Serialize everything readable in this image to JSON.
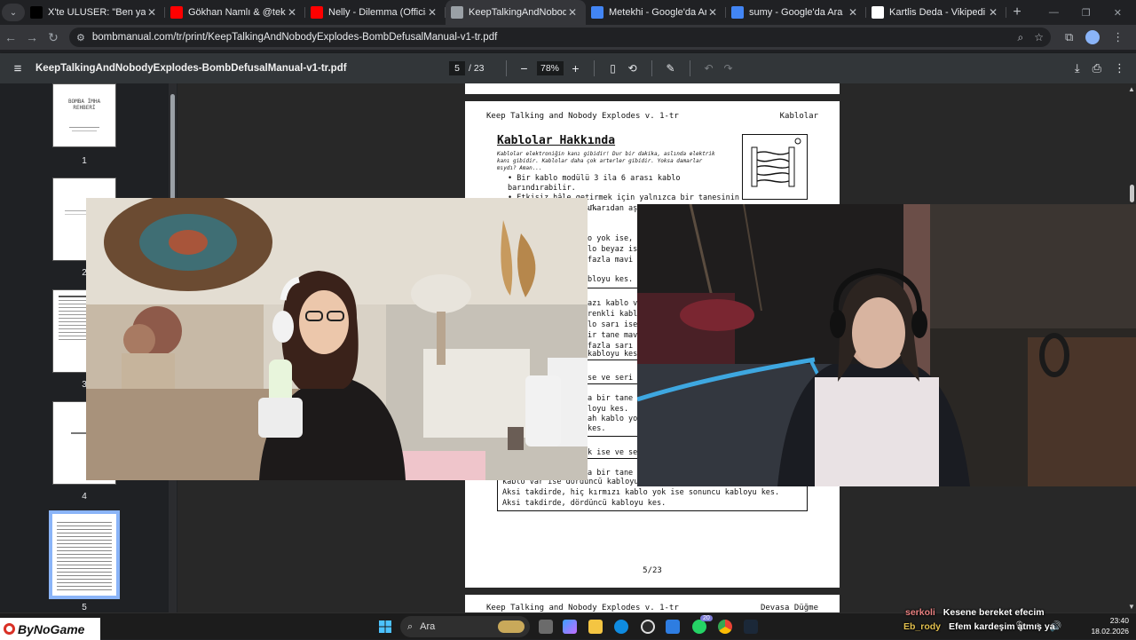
{
  "browser": {
    "tabs": [
      {
        "title": "X'te ULUSER: \"Ben yanlışım du",
        "favicon": "x-icon",
        "color": "#000000",
        "active": false
      },
      {
        "title": "Gökhan Namlı & @tekironline",
        "favicon": "youtube-icon",
        "color": "#ff0000",
        "active": false
      },
      {
        "title": "Nelly - Dilemma (Official Music",
        "favicon": "youtube-icon",
        "color": "#ff0000",
        "active": false
      },
      {
        "title": "KeepTalkingAndNobodyExplode",
        "favicon": "globe-icon",
        "color": "#9aa0a6",
        "active": true
      },
      {
        "title": "Metekhi - Google'da Ara",
        "favicon": "google-icon",
        "color": "#4285f4",
        "active": false
      },
      {
        "title": "sumy - Google'da Ara",
        "favicon": "google-icon",
        "color": "#4285f4",
        "active": false
      },
      {
        "title": "Kartlis Deda - Vikipedi",
        "favicon": "wikipedia-icon",
        "color": "#ffffff",
        "active": false
      }
    ],
    "url": "bombmanual.com/tr/print/KeepTalkingAndNobodyExplodes-BombDefusalManual-v1-tr.pdf"
  },
  "pdf": {
    "filename": "KeepTalkingAndNobodyExplodes-BombDefusalManual-v1-tr.pdf",
    "current_page": "5",
    "total_pages": "/ 23",
    "zoom": "78%",
    "thumbnails": [
      {
        "num": "1",
        "title": "BOMBA İMHA REHBERİ"
      },
      {
        "num": "2"
      },
      {
        "num": "3"
      },
      {
        "num": "4"
      },
      {
        "num": "5"
      }
    ]
  },
  "page5": {
    "header_left": "Keep Talking and Nobody Explodes v. 1-tr",
    "header_right": "Kablolar",
    "title": "Kablolar Hakkında",
    "intro": "Kablolar elektroniğin kanı gibidir! Dur bir dakika, aslında elektrik kanı gibidir. Kablolar daha çok arterler gibidir. Yoksa damarlar mıydı? Aman...",
    "bullet1": "• Bir kablo modülü 3 ila 6 arası kablo barındırabilir.",
    "bullet2": "• Etkisiz hâle getirmek için yalnızca bir tanesinin",
    "bullet2b": "kesilmesi gerekir.",
    "frag1": "ukarıdan aşa",
    "frag2": "o yok ise, iki",
    "frag3": "lo beyaz ise,",
    "frag4": "fazla mavi ka",
    "frag5": "bloyu kes.",
    "frag6": "azı kablo va",
    "frag7": "renkli kablo",
    "frag8": "lo sarı ise v",
    "frag9": "ir tane mavi",
    "frag10": "fazla sarı k",
    "frag11": "kabloyu kes.",
    "frag12": "se ve seri nu",
    "frag13": "a bir tane k",
    "frag14": "loyu kes.",
    "frag15": "ah kablo yok",
    "frag16": "kes.",
    "frag17": "k ise ve seri",
    "frag18": "a bir tane s",
    "line_a": "kablo var ise dördüncü kabloyu kes.",
    "line_b": "Aksi takdirde, hiç kırmızı kablo yok ise sonuncu kabloyu kes.",
    "line_c": "Aksi takdirde, dördüncü kabloyu kes.",
    "page_number": "5/23"
  },
  "page6": {
    "header_left": "Keep Talking and Nobody Explodes v. 1-tr",
    "header_right": "Devasa Düğme"
  },
  "overlay": {
    "logo": "ByNoGame",
    "chat": [
      {
        "user": "serkoli",
        "message": "Kesene bereket efecim"
      },
      {
        "user": "Eb_rody",
        "message": "Efem kardeşim atmış ya"
      }
    ]
  },
  "taskbar": {
    "search_placeholder": "Ara",
    "badge": "20",
    "time": "23:40",
    "date": "18.02.2026"
  }
}
